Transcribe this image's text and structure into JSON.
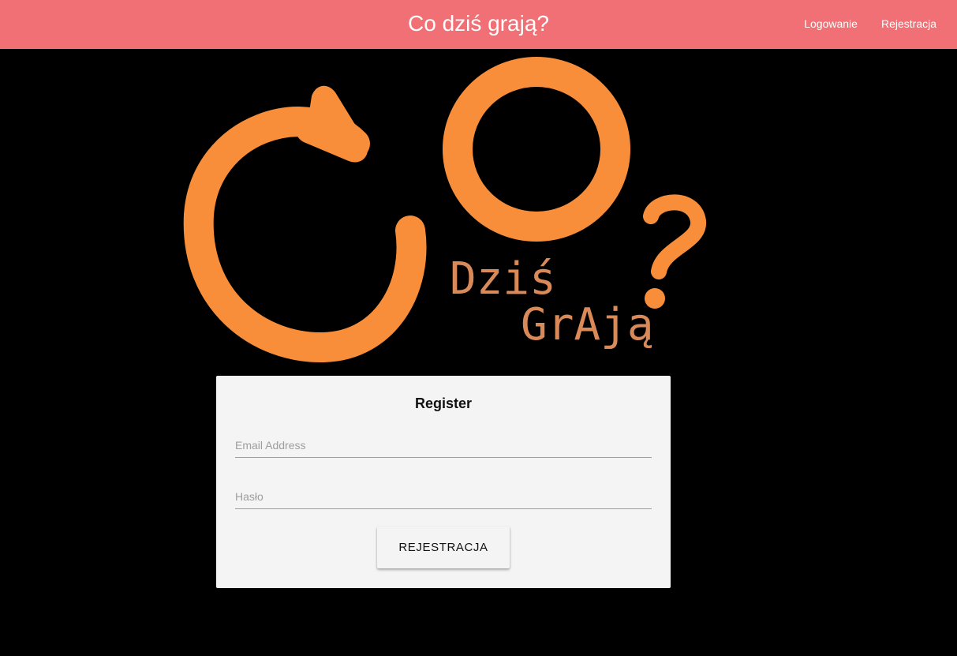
{
  "header": {
    "title": "Co dziś grają?",
    "nav": [
      {
        "label": "Logowanie"
      },
      {
        "label": "Rejestracja"
      }
    ],
    "background_color": "#f07075"
  },
  "logo": {
    "line1": "Dziś",
    "line2": "GrAją",
    "question_mark": "?",
    "color": "#f98e3a"
  },
  "form": {
    "title": "Register",
    "email": {
      "placeholder": "Email Address",
      "value": ""
    },
    "password": {
      "placeholder": "Hasło",
      "value": ""
    },
    "submit_label": "REJESTRACJA"
  }
}
